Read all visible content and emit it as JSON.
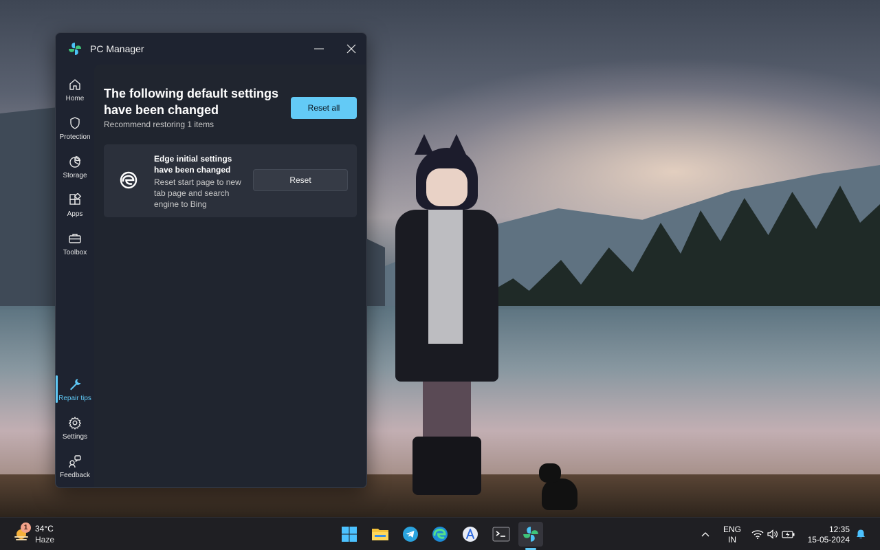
{
  "window": {
    "title": "PC Manager",
    "minimize_label": "Minimize",
    "close_label": "Close"
  },
  "nav": {
    "items": [
      {
        "label": "Home",
        "icon": "home-icon"
      },
      {
        "label": "Protection",
        "icon": "shield-icon"
      },
      {
        "label": "Storage",
        "icon": "pie-chart-icon"
      },
      {
        "label": "Apps",
        "icon": "apps-icon"
      },
      {
        "label": "Toolbox",
        "icon": "toolbox-icon"
      },
      {
        "label": "Repair tips",
        "icon": "wrench-icon",
        "active": true
      },
      {
        "label": "Settings",
        "icon": "gear-icon"
      },
      {
        "label": "Feedback",
        "icon": "feedback-icon"
      }
    ]
  },
  "main": {
    "heading": "The following default settings have been changed",
    "subheading": "Recommend restoring 1 items",
    "reset_all_label": "Reset all",
    "card": {
      "title": "Edge initial settings have been changed",
      "description": "Reset start page to new tab page and search engine to Bing",
      "reset_label": "Reset",
      "icon": "edge-icon"
    }
  },
  "taskbar": {
    "weather": {
      "badge": "1",
      "temperature": "34°C",
      "condition": "Haze"
    },
    "apps": [
      "start-icon",
      "file-explorer-icon",
      "telegram-icon",
      "edge-icon",
      "app-store-icon",
      "terminal-icon",
      "pc-manager-icon"
    ],
    "language": {
      "line1": "ENG",
      "line2": "IN"
    },
    "clock": {
      "time": "12:35",
      "date": "15-05-2024"
    }
  },
  "colors": {
    "accent": "#5fc8f5",
    "window_bg": "#1e2330",
    "content_bg": "#20252f",
    "card_bg": "#2b303b",
    "taskbar_bg": "#1f1f23"
  }
}
